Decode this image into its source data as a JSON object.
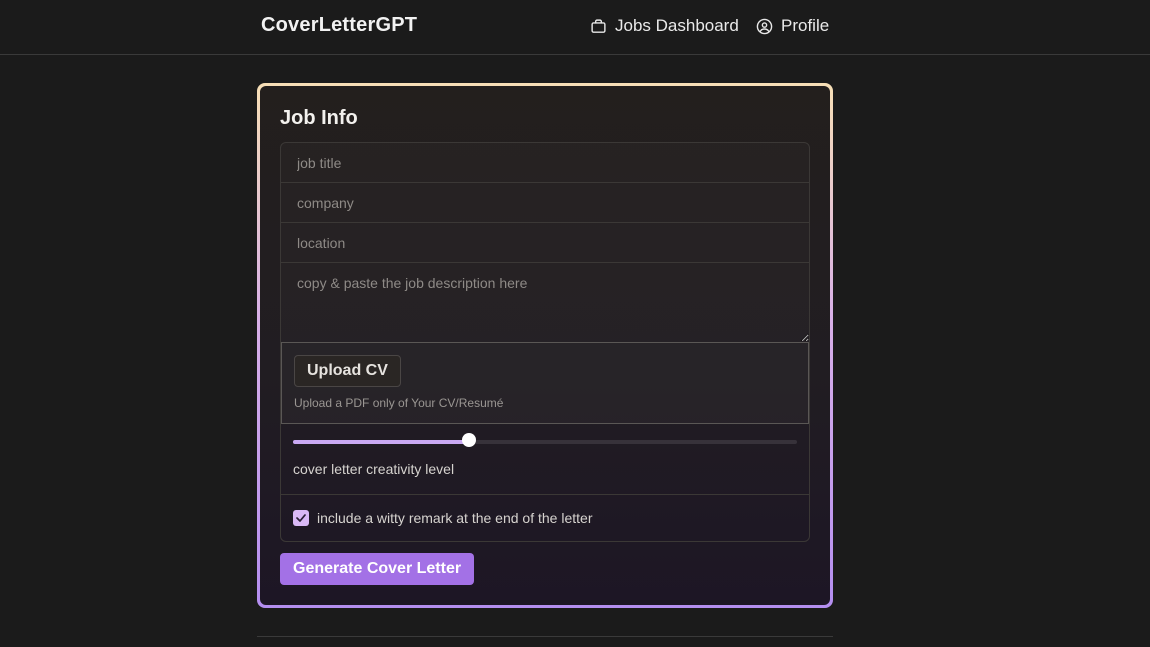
{
  "app": {
    "brand": "CoverLetterGPT"
  },
  "nav": {
    "jobs_dashboard": "Jobs Dashboard",
    "profile": "Profile"
  },
  "job_info": {
    "title": "Job Info",
    "job_title_placeholder": "job title",
    "company_placeholder": "company",
    "location_placeholder": "location",
    "description_placeholder": "copy & paste the job description here",
    "upload_button": "Upload CV",
    "upload_hint": "Upload a PDF only of Your CV/Resumé",
    "creativity_label": "cover letter creativity level",
    "creativity_value": 0.35,
    "witty_label": "include a witty remark at the end of the letter",
    "witty_checked": true,
    "generate_button": "Generate Cover Letter"
  },
  "colors": {
    "accent": "#a371e6",
    "slider_fill": "#c9a9f3",
    "checkbox": "#d9b8f5"
  }
}
